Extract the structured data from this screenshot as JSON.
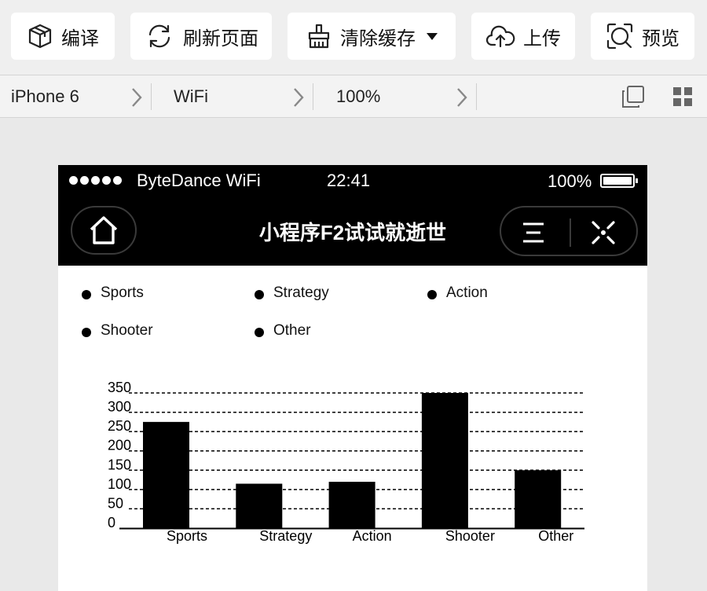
{
  "toolbar": {
    "compile": "编译",
    "refresh": "刷新页面",
    "clear_cache": "清除缓存",
    "upload": "上传",
    "preview": "预览"
  },
  "devbar": {
    "device": "iPhone 6",
    "network": "WiFi",
    "zoom": "100%"
  },
  "phone": {
    "carrier": "ByteDance WiFi",
    "time": "22:41",
    "battery": "100%",
    "title": "小程序F2试试就逝世"
  },
  "legend": [
    "Sports",
    "Strategy",
    "Action",
    "Shooter",
    "Other"
  ],
  "chart_data": {
    "type": "bar",
    "categories": [
      "Sports",
      "Strategy",
      "Action",
      "Shooter",
      "Other"
    ],
    "values": [
      275,
      115,
      120,
      350,
      150
    ],
    "yticks": [
      0,
      50,
      100,
      150,
      200,
      250,
      300,
      350
    ],
    "ylim": [
      0,
      350
    ],
    "grid": true,
    "legend_position": "top"
  }
}
